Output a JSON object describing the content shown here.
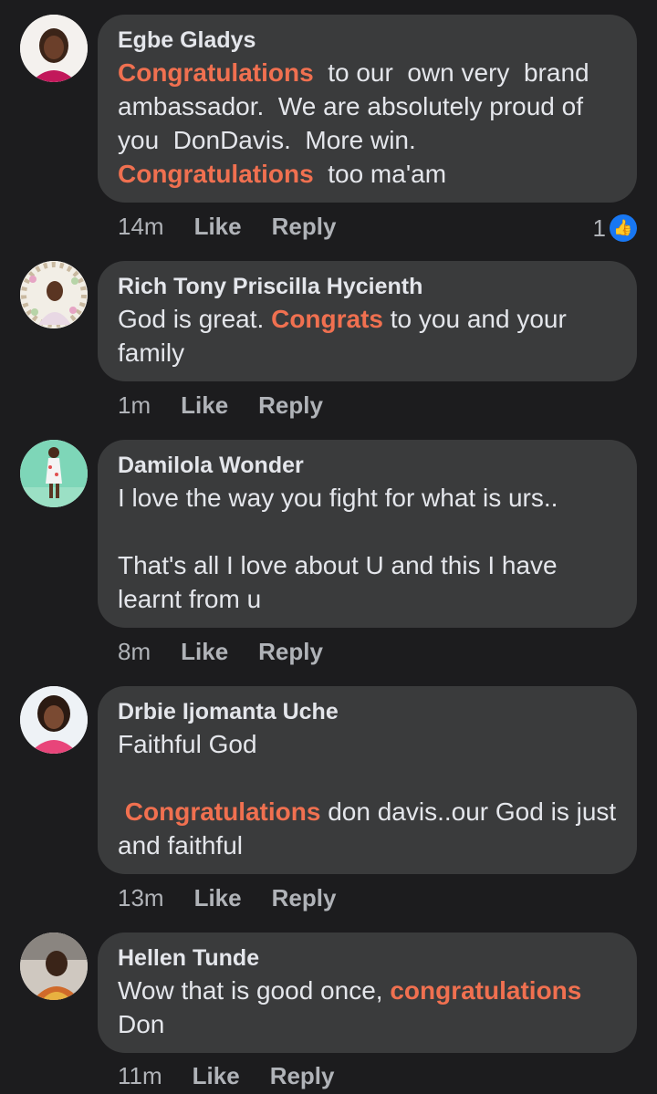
{
  "comments": [
    {
      "author": "Egbe Gladys",
      "segments": [
        {
          "text": "Congratulations",
          "hl": true
        },
        {
          "text": "  to our  own very  brand ambassador.  We are absolutely proud of you  DonDavis.  More win.\n",
          "hl": false
        },
        {
          "text": "Congratulations",
          "hl": true
        },
        {
          "text": "  too ma'am",
          "hl": false
        }
      ],
      "time": "14m",
      "like": "Like",
      "reply": "Reply",
      "likes": "1"
    },
    {
      "author": "Rich Tony Priscilla Hycienth",
      "segments": [
        {
          "text": "God is great. ",
          "hl": false
        },
        {
          "text": "Congrats",
          "hl": true
        },
        {
          "text": " to you and your family",
          "hl": false
        }
      ],
      "time": "1m",
      "like": "Like",
      "reply": "Reply"
    },
    {
      "author": "Damilola Wonder",
      "segments": [
        {
          "text": "I love the way you fight for what is urs..\n\nThat's all I love about U and this I have learnt from u",
          "hl": false
        }
      ],
      "time": "8m",
      "like": "Like",
      "reply": "Reply"
    },
    {
      "author": "Drbie Ijomanta Uche",
      "segments": [
        {
          "text": "Faithful God\n\n ",
          "hl": false
        },
        {
          "text": "Congratulations",
          "hl": true
        },
        {
          "text": " don davis..our God is just and faithful",
          "hl": false
        }
      ],
      "time": "13m",
      "like": "Like",
      "reply": "Reply"
    },
    {
      "author": "Hellen Tunde",
      "segments": [
        {
          "text": "Wow that is good once, ",
          "hl": false
        },
        {
          "text": "congratulations",
          "hl": true
        },
        {
          "text": " Don",
          "hl": false
        }
      ],
      "time": "11m",
      "like": "Like",
      "reply": "Reply"
    }
  ],
  "colors": {
    "background": "#1c1c1e",
    "bubble": "#3a3b3c",
    "highlight": "#f07050",
    "like_badge": "#1877f2"
  },
  "icons": {
    "like_badge": "thumbs-up-icon"
  }
}
